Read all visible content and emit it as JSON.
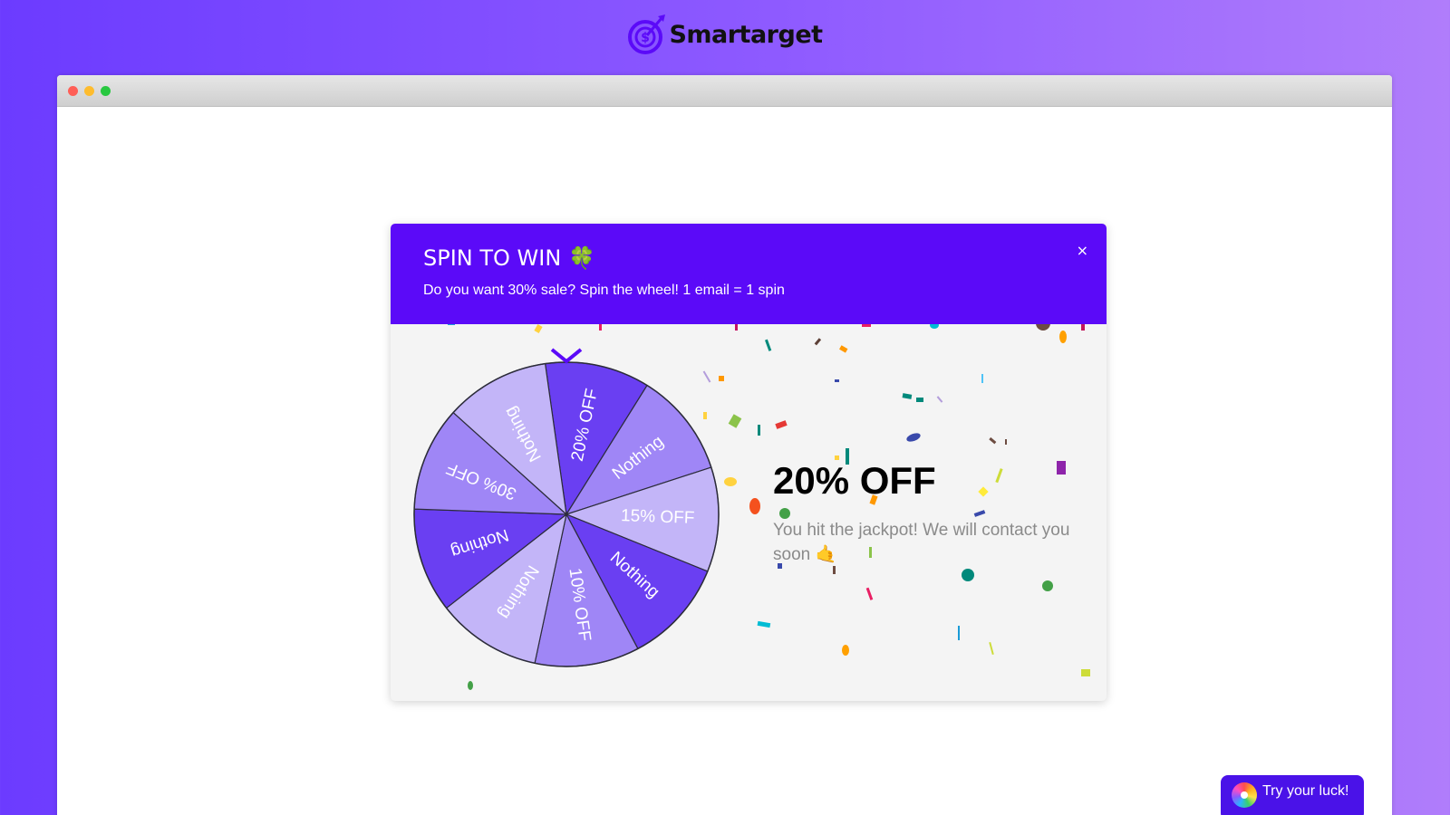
{
  "brand": {
    "name": "Smartarget",
    "logo_color": "#5b0af8"
  },
  "browser": {
    "dots": [
      "#ff5f57",
      "#febc2e",
      "#28c840"
    ]
  },
  "popup": {
    "title": "SPIN TO WIN 🍀",
    "subtitle": "Do you want 30% sale? Spin the wheel! 1 email = 1 spin",
    "close_label": "×",
    "header_color": "#5b0af8",
    "wheel": {
      "pointer_icon": "chevron-down-icon",
      "segments": [
        {
          "label": "20% OFF",
          "color": "#6a3ff2"
        },
        {
          "label": "Nothing",
          "color": "#9f86f6"
        },
        {
          "label": "15% OFF",
          "color": "#c3b5f8"
        },
        {
          "label": "Nothing",
          "color": "#6a3ff2"
        },
        {
          "label": "10% OFF",
          "color": "#9f86f6"
        },
        {
          "label": "Nothing",
          "color": "#c3b5f8"
        },
        {
          "label": "Nothing",
          "color": "#6a3ff2"
        },
        {
          "label": "30% OFF",
          "color": "#9f86f6"
        },
        {
          "label": "Nothing",
          "color": "#c3b5f8"
        }
      ]
    },
    "result": {
      "title": "20% OFF",
      "message": "You hit the jackpot! We will contact you soon 🤙"
    }
  },
  "launcher": {
    "label": "Try your luck!",
    "icon": "wheel-icon"
  }
}
